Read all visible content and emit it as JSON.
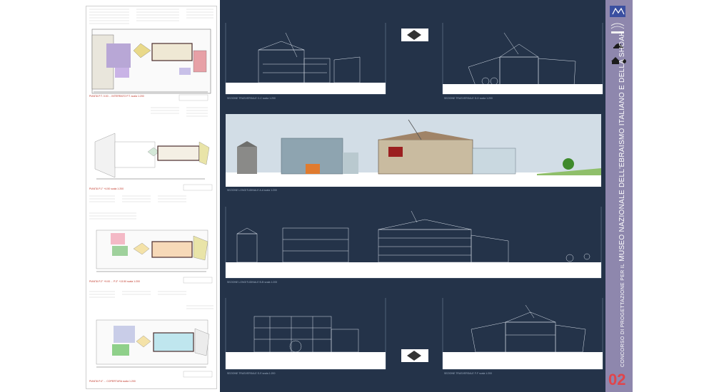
{
  "board": {
    "sheet_number": "02",
    "title_prefix": "CONCORSO DI PROGETTAZIONE PER IL",
    "title_main": "MUSEO NAZIONALE DELL'EBRAISMO ITALIANO E DELLA SHOAH",
    "accent_color": "#e0454b",
    "background_color": "#243349",
    "strip_color": "#8e87ad"
  },
  "logos": [
    "mibac-logo",
    "meis-logo",
    "dome-logo",
    "unesco-logo"
  ],
  "panels": {
    "section_1": {
      "caption": "SEZIONE TRASVERSALE C-C  scala 1:200"
    },
    "section_2": {
      "caption": "SEZIONE TRASVERSALE D-D  scala 1:200"
    },
    "long_section_render": {
      "caption": "SEZIONE LONGITUDINALE A-A  scala 1:200"
    },
    "long_section": {
      "caption": "SEZIONE LONGITUDINALE B-B  scala 1:200"
    },
    "section_3": {
      "caption": "SEZIONE TRASVERSALE E-E  scala 1:200"
    },
    "section_4": {
      "caption": "SEZIONE TRASVERSALE F-F  scala 1:200"
    }
  },
  "plans": [
    {
      "caption": "PIANTA  P.T. 0.00 ... INTERRATO P.T.  scala 1:200"
    },
    {
      "caption": "PIANTA  P.1° +4.50  scala 1:200"
    },
    {
      "caption": "PIANTA  P.2° +9.00 ... P.3° +13.50  scala 1:200"
    },
    {
      "caption": "PIANTA  P.4° ... COPERTURA  scala 1:200"
    }
  ]
}
